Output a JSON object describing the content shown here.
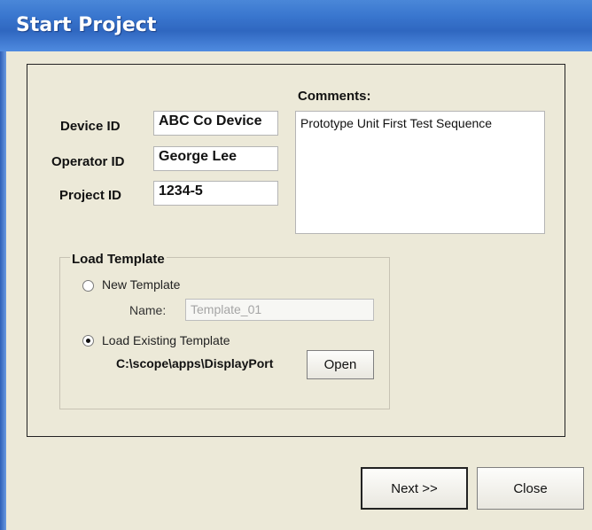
{
  "window": {
    "title": "Start Project"
  },
  "fields": {
    "device_id_label": "Device ID",
    "device_id_value": "ABC Co Device",
    "operator_id_label": "Operator ID",
    "operator_id_value": "George Lee",
    "project_id_label": "Project ID",
    "project_id_value": "1234-5"
  },
  "comments": {
    "label": "Comments:",
    "value": "Prototype Unit First Test Sequence"
  },
  "template": {
    "group_label": "Load Template",
    "new_template_label": "New Template",
    "name_label": "Name:",
    "name_placeholder": "Template_01",
    "load_existing_label": "Load Existing Template",
    "path": "C:\\scope\\apps\\DisplayPort",
    "open_label": "Open",
    "selected": "load_existing"
  },
  "buttons": {
    "next_label": "Next >>",
    "close_label": "Close"
  }
}
